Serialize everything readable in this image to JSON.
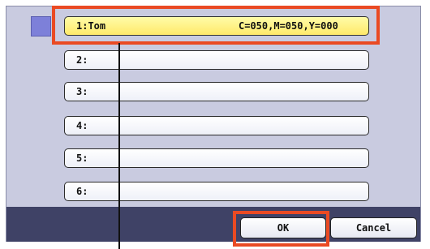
{
  "slots": [
    {
      "number": "1:",
      "name": "Tom",
      "color_values": "C=050,M=050,Y=000",
      "selected": true
    },
    {
      "number": "2:",
      "name": "",
      "color_values": "",
      "selected": false
    },
    {
      "number": "3:",
      "name": "",
      "color_values": "",
      "selected": false
    },
    {
      "number": "4:",
      "name": "",
      "color_values": "",
      "selected": false
    },
    {
      "number": "5:",
      "name": "",
      "color_values": "",
      "selected": false
    },
    {
      "number": "6:",
      "name": "",
      "color_values": "",
      "selected": false
    }
  ],
  "buttons": {
    "ok_label": "OK",
    "cancel_label": "Cancel"
  },
  "colors": {
    "highlight": "#ea4a23",
    "selected_slot": "#fff27a",
    "panel": "#c9cbe0",
    "bottom_bar": "#3f4266",
    "indicator": "#7d80d9"
  }
}
